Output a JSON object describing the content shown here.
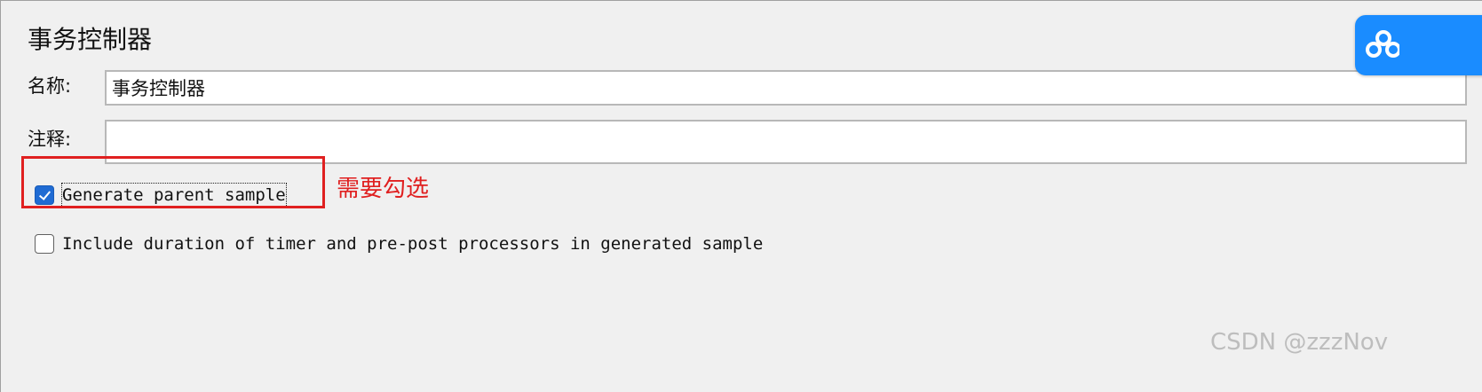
{
  "page": {
    "title": "事务控制器"
  },
  "form": {
    "name_label": "名称:",
    "name_value": "事务控制器",
    "comment_label": "注释:",
    "comment_value": ""
  },
  "options": [
    {
      "label": "Generate parent sample",
      "checked": true
    },
    {
      "label": "Include duration of timer and pre-post processors in generated sample",
      "checked": false
    }
  ],
  "annotation": {
    "text": "需要勾选",
    "color": "#e02020"
  },
  "floating_widget": {
    "icon": "link-nodes-icon",
    "color": "#1a8cff"
  },
  "watermark": {
    "text": "CSDN @zzzNov"
  },
  "colors": {
    "panel_background": "#f0f0f0",
    "checkbox_checked": "#1f6bd3"
  }
}
